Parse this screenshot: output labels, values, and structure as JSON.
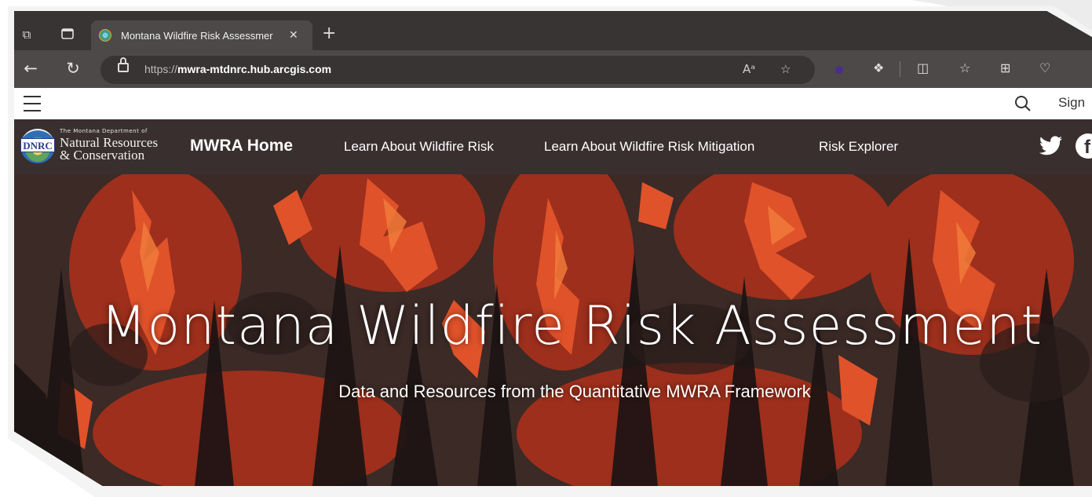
{
  "browser": {
    "tab_title": "Montana Wildfire Risk Assessmer",
    "url_prefix": "https://",
    "url_domain": "mwra-mtdnrc.hub.arcgis.com",
    "read_aloud_label": "Aᵃ"
  },
  "site_header": {
    "sign_in": "Sign"
  },
  "nav": {
    "logo_small": "The Montana Department of",
    "logo_line1": "Natural Resources",
    "logo_line2": "& Conservation",
    "logo_badge": "DNRC",
    "home": "MWRA Home",
    "links": [
      "Learn About Wildfire Risk",
      "Learn About Wildfire Risk Mitigation",
      "Risk Explorer"
    ],
    "facebook_glyph": "f"
  },
  "hero": {
    "title": "Montana Wildfire Risk Assessment",
    "subtitle": "Data and Resources from the Quantitative MWRA Framework"
  },
  "colors": {
    "browser_dark": "#383434",
    "browser_mid": "#4d4949",
    "nav_bg": "#3a2f2f",
    "fire_orange": "#e0522a",
    "fire_deep": "#a8301c"
  }
}
